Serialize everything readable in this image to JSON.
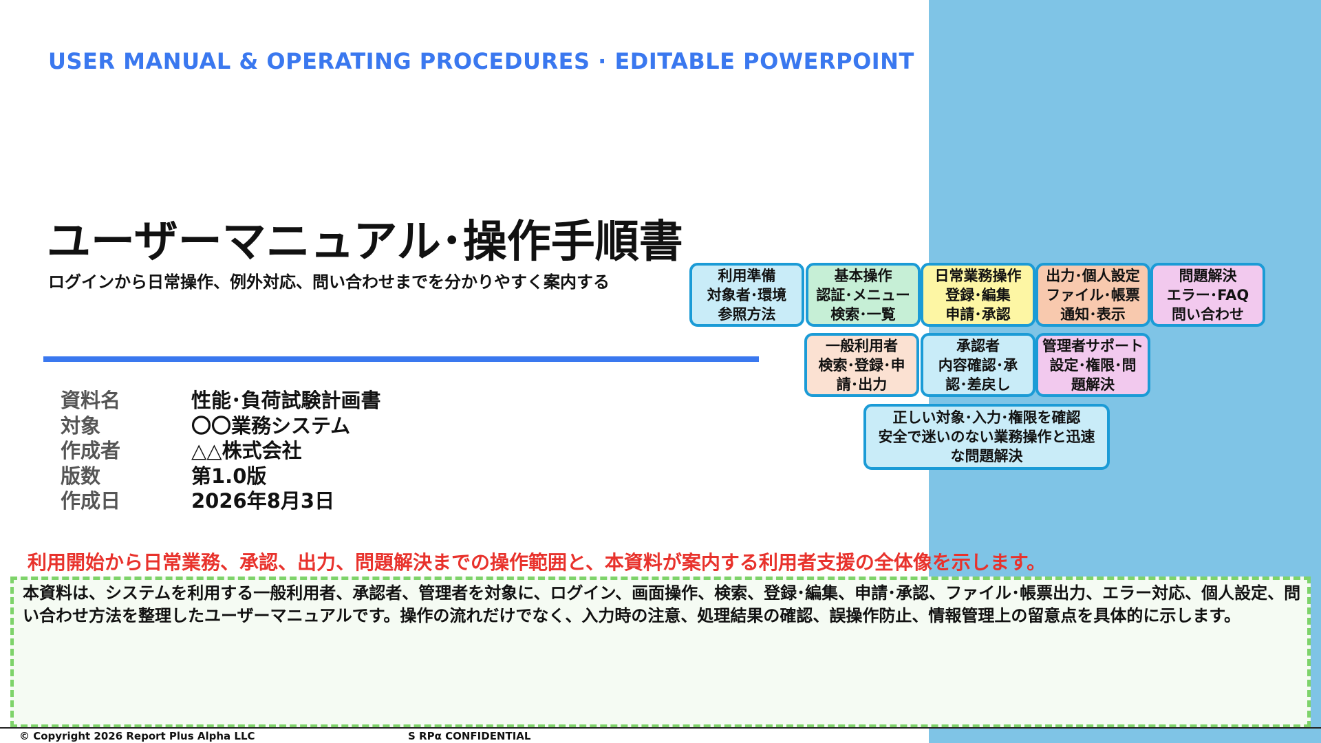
{
  "header": {
    "label": "USER MANUAL & OPERATING PROCEDURES · EDITABLE POWERPOINT"
  },
  "title": {
    "main": "ユーザーマニュアル･操作手順書",
    "subtitle": "ログインから日常操作、例外対応、問い合わせまでを分かりやすく案内する"
  },
  "meta": [
    {
      "label": "資料名",
      "value": "性能･負荷試験計画書"
    },
    {
      "label": "対象",
      "value": "〇〇業務システム"
    },
    {
      "label": "作成者",
      "value": "△△株式会社"
    },
    {
      "label": "版数",
      "value": "第1.0版"
    },
    {
      "label": "作成日",
      "value": "2026年8月3日"
    }
  ],
  "diagram": {
    "row1": [
      {
        "lines": [
          "利用準備",
          "対象者･環境",
          "参照方法"
        ],
        "color": "#c9ecf8"
      },
      {
        "lines": [
          "基本操作",
          "認証･メニュー",
          "検索･一覧"
        ],
        "color": "#c6efd6"
      },
      {
        "lines": [
          "日常業務操作",
          "登録･編集",
          "申請･承認"
        ],
        "color": "#fdf6a4"
      },
      {
        "lines": [
          "出力･個人設定",
          "ファイル･帳票",
          "通知･表示"
        ],
        "color": "#f8c9ae"
      },
      {
        "lines": [
          "問題解決",
          "エラー･FAQ",
          "問い合わせ"
        ],
        "color": "#f2c9ee"
      }
    ],
    "row2": [
      {
        "lines": [
          "一般利用者",
          "検索･登録･申",
          "請･出力"
        ],
        "color": "#fbe1d2"
      },
      {
        "lines": [
          "承認者",
          "内容確認･承",
          "認･差戻し"
        ],
        "color": "#c9ecf8"
      },
      {
        "lines": [
          "管理者サポート",
          "設定･権限･問",
          "題解決"
        ],
        "color": "#f2c9ee"
      }
    ],
    "row3": {
      "lines": [
        "正しい対象･入力･権限を確認",
        "安全で迷いのない業務操作と迅速",
        "な問題解決"
      ],
      "color": "#c9ecf8"
    }
  },
  "summary": {
    "headline": "利用開始から日常業務、承認、出力、問題解決までの操作範囲と、本資料が案内する利用者支援の全体像を示します。",
    "body": "本資料は、システムを利用する一般利用者、承認者、管理者を対象に、ログイン、画面操作、検索、登録･編集、申請･承認、ファイル･帳票出力、エラー対応、個人設定、問い合わせ方法を整理したユーザーマニュアルです。操作の流れだけでなく、入力時の注意、処理結果の確認、誤操作防止、情報管理上の留意点を具体的に示します。"
  },
  "footer": {
    "copyright": "© Copyright 2026 Report Plus Alpha LLC",
    "confidential": "S RPα CONFIDENTIAL"
  },
  "colors": {
    "accent_blue": "#3a78ef",
    "panel_blue": "#7fc4e6",
    "headline_red": "#e8322c",
    "box_border": "#1b9bd6",
    "dashed_green": "#7ed36a"
  }
}
